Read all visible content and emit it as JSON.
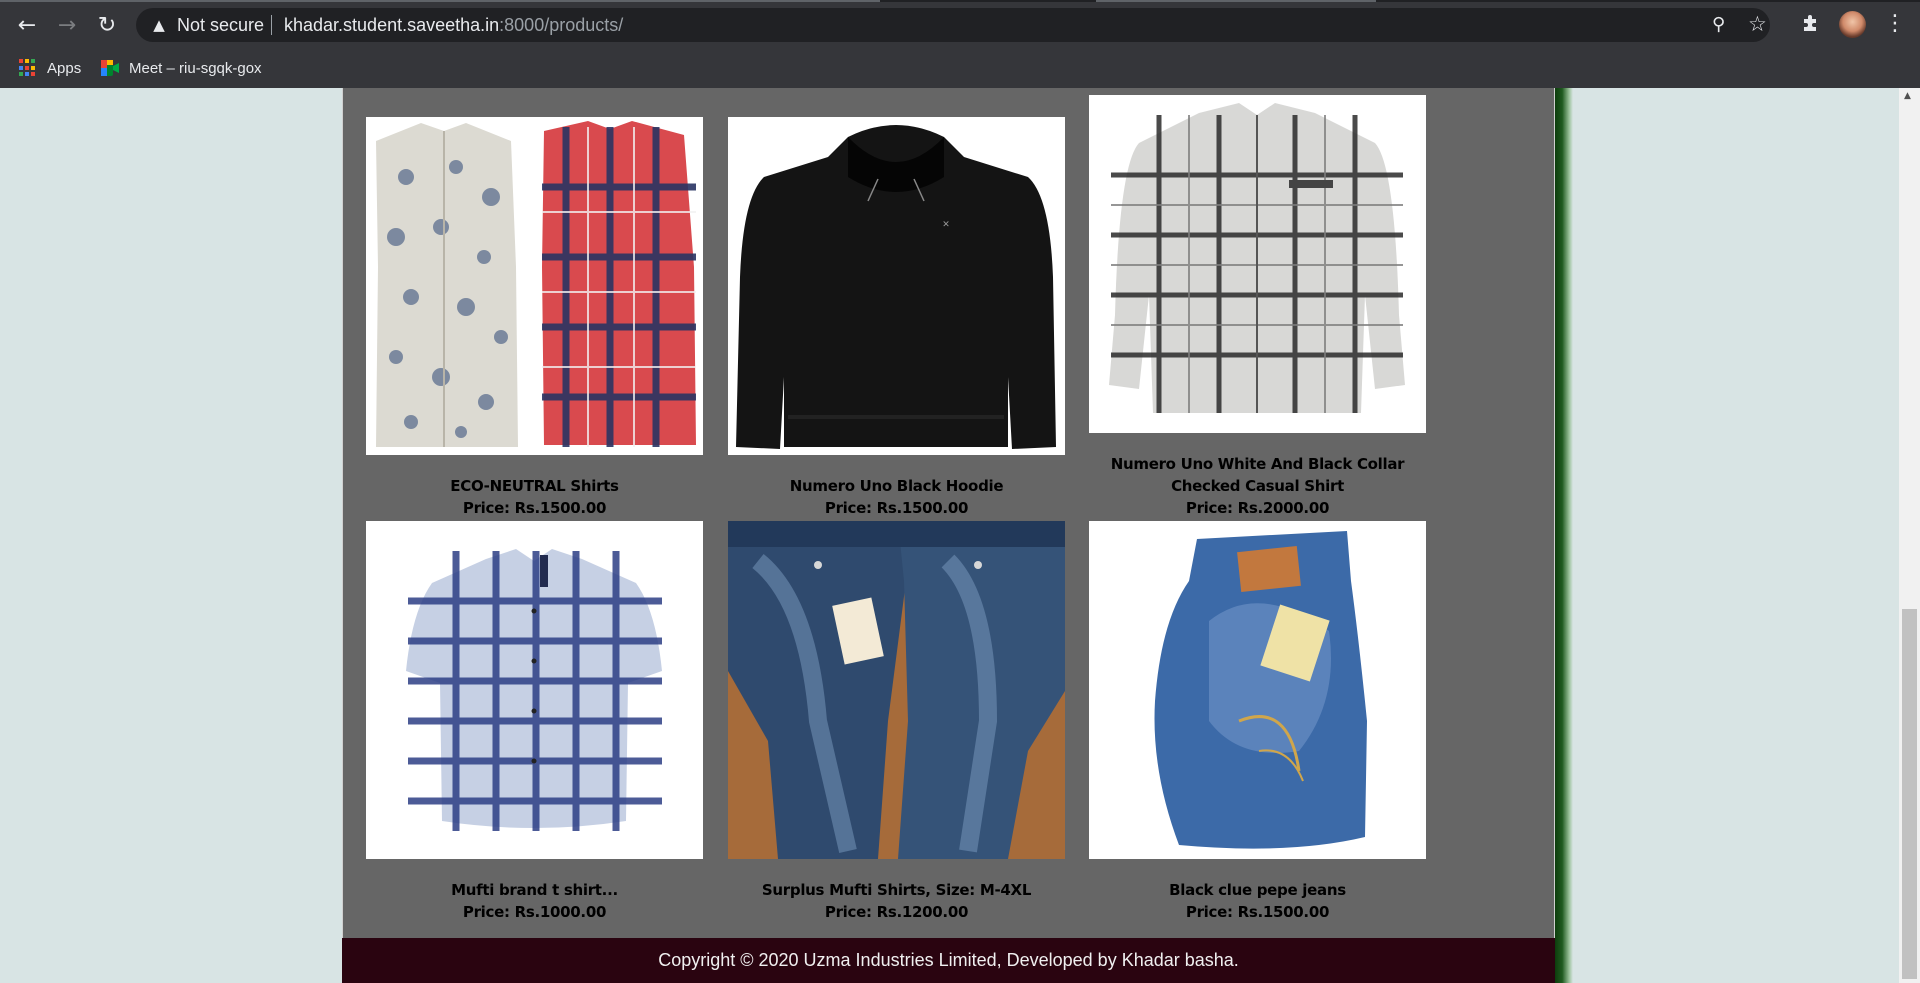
{
  "browser": {
    "security_label": "Not secure",
    "url_host": "khadar.student.saveetha.in",
    "url_rest": ":8000/products/",
    "bookmarks": [
      {
        "label": "Apps",
        "icon": "apps-grid-icon"
      },
      {
        "label": "Meet – riu-sgqk-gox",
        "icon": "google-meet-icon"
      }
    ]
  },
  "products": [
    {
      "name": "ECO-NEUTRAL Shirts",
      "price": "Price: Rs.1500.00",
      "image": "checked-shirts-pair"
    },
    {
      "name": "Numero Uno Black Hoodie",
      "price": "Price: Rs.1500.00",
      "image": "black-hoodie"
    },
    {
      "name": "Numero Uno White And Black Collar Checked Casual Shirt",
      "price": "Price: Rs.2000.00",
      "image": "grey-checked-shirt"
    },
    {
      "name": "Mufti brand t shirt...",
      "price": "Price: Rs.1000.00",
      "image": "blue-checked-shirt"
    },
    {
      "name": "Surplus Mufti Shirts, Size: M-4XL",
      "price": "Price: Rs.1200.00",
      "image": "mufti-jeans-pair"
    },
    {
      "name": "Black clue pepe jeans",
      "price": "Price: Rs.1500.00",
      "image": "blue-jeans-back"
    }
  ],
  "footer": {
    "text": "Copyright © 2020 Uzma Industries Limited, Developed by Khadar basha."
  },
  "colors": {
    "content_bg": "#666666",
    "footer_bg": "#2a0410",
    "page_bg": "#d8e4e4"
  }
}
